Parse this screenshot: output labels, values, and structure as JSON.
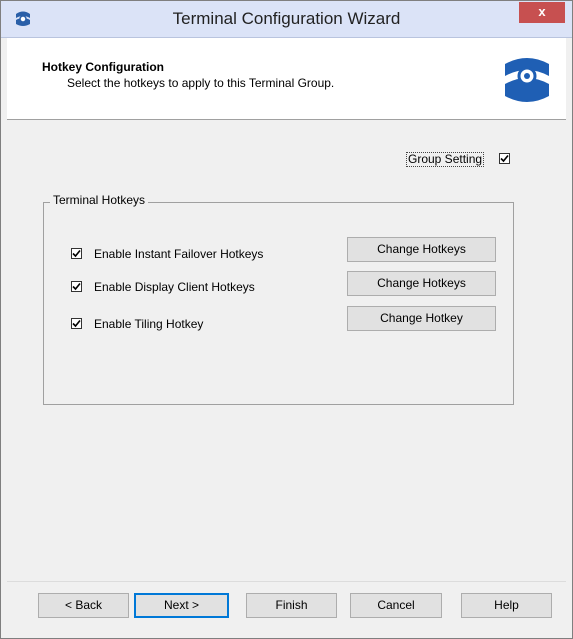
{
  "window": {
    "title": "Terminal Configuration Wizard",
    "close_label": "x"
  },
  "header": {
    "title": "Hotkey Configuration",
    "subtitle": "Select the hotkeys to apply to this Terminal Group."
  },
  "group_setting": {
    "label": "Group Setting",
    "checked": true
  },
  "terminal_hotkeys": {
    "legend": "Terminal Hotkeys",
    "options": [
      {
        "label": "Enable Instant Failover Hotkeys",
        "checked": true,
        "button": "Change Hotkeys"
      },
      {
        "label": "Enable Display Client Hotkeys",
        "checked": true,
        "button": "Change Hotkeys"
      },
      {
        "label": "Enable Tiling Hotkey",
        "checked": true,
        "button": "Change Hotkey"
      }
    ]
  },
  "footer": {
    "back": "< Back",
    "next": "Next >",
    "finish": "Finish",
    "cancel": "Cancel",
    "help": "Help"
  }
}
